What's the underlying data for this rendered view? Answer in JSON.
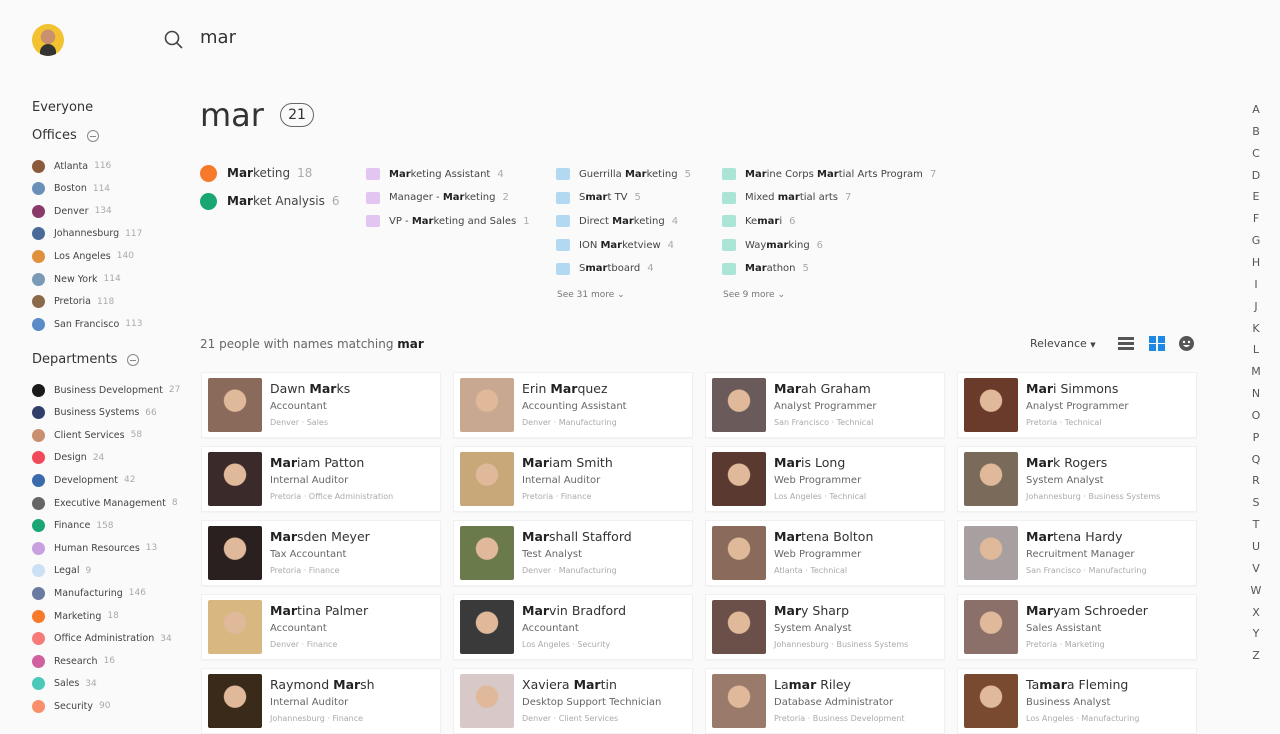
{
  "search": {
    "value": "mar"
  },
  "sidebar": {
    "everyone": "Everyone",
    "offices_title": "Offices",
    "departments_title": "Departments",
    "offices": [
      {
        "label": "Atlanta",
        "count": "116",
        "color": "#8a5a3c"
      },
      {
        "label": "Boston",
        "count": "114",
        "color": "#6a8fb8"
      },
      {
        "label": "Denver",
        "count": "134",
        "color": "#8a3a6a"
      },
      {
        "label": "Johannesburg",
        "count": "117",
        "color": "#4a6a9a"
      },
      {
        "label": "Los Angeles",
        "count": "140",
        "color": "#e0903a"
      },
      {
        "label": "New York",
        "count": "114",
        "color": "#7a9ab8"
      },
      {
        "label": "Pretoria",
        "count": "118",
        "color": "#8a6a4a"
      },
      {
        "label": "San Francisco",
        "count": "113",
        "color": "#5a8ac8"
      }
    ],
    "departments": [
      {
        "label": "Business Development",
        "count": "27",
        "color": "#1a1a1a"
      },
      {
        "label": "Business Systems",
        "count": "66",
        "color": "#2f3f6a"
      },
      {
        "label": "Client Services",
        "count": "58",
        "color": "#c98f6e"
      },
      {
        "label": "Design",
        "count": "24",
        "color": "#f04a5a"
      },
      {
        "label": "Development",
        "count": "42",
        "color": "#3a6aaa"
      },
      {
        "label": "Executive Management",
        "count": "8",
        "color": "#666666"
      },
      {
        "label": "Finance",
        "count": "158",
        "color": "#1aa673"
      },
      {
        "label": "Human Resources",
        "count": "13",
        "color": "#c8a0e0"
      },
      {
        "label": "Legal",
        "count": "9",
        "color": "#cce0f5"
      },
      {
        "label": "Manufacturing",
        "count": "146",
        "color": "#6a7aa0"
      },
      {
        "label": "Marketing",
        "count": "18",
        "color": "#f77a2a"
      },
      {
        "label": "Office Administration",
        "count": "34",
        "color": "#f77a7a"
      },
      {
        "label": "Research",
        "count": "16",
        "color": "#d060a0"
      },
      {
        "label": "Sales",
        "count": "34",
        "color": "#4ac8b8"
      },
      {
        "label": "Security",
        "count": "90",
        "color": "#f7906a"
      }
    ]
  },
  "query": {
    "title": "mar",
    "count": "21"
  },
  "suggestions": {
    "departments": [
      {
        "parts": [
          "",
          "Mar",
          "keting"
        ],
        "count": "18",
        "color": "#f77a2a"
      },
      {
        "parts": [
          "",
          "Mar",
          "ket Analysis"
        ],
        "count": "6",
        "color": "#1aa673"
      }
    ],
    "titles": [
      {
        "parts": [
          "",
          "Mar",
          "keting Assistant"
        ],
        "count": "4"
      },
      {
        "parts": [
          "Manager - ",
          "Mar",
          "keting"
        ],
        "count": "2"
      },
      {
        "parts": [
          "VP - ",
          "Mar",
          "keting and Sales"
        ],
        "count": "1"
      }
    ],
    "skills": [
      {
        "parts": [
          "Guerrilla ",
          "Mar",
          "keting"
        ],
        "count": "5"
      },
      {
        "parts": [
          "S",
          "mar",
          "t TV"
        ],
        "count": "5"
      },
      {
        "parts": [
          "Direct ",
          "Mar",
          "keting"
        ],
        "count": "4"
      },
      {
        "parts": [
          "ION ",
          "Mar",
          "ketview"
        ],
        "count": "4"
      },
      {
        "parts": [
          "S",
          "mar",
          "tboard"
        ],
        "count": "4"
      }
    ],
    "skills_more": "See 31 more",
    "interests": [
      {
        "parts": [
          "",
          "Mar",
          "ine Corps ",
          "Mar",
          "tial Arts Program"
        ],
        "count": "7"
      },
      {
        "parts": [
          "Mixed ",
          "mar",
          "tial arts"
        ],
        "count": "7"
      },
      {
        "parts": [
          "Ke",
          "mar",
          "i"
        ],
        "count": "6"
      },
      {
        "parts": [
          "Way",
          "mar",
          "king"
        ],
        "count": "6"
      },
      {
        "parts": [
          "",
          "Mar",
          "athon"
        ],
        "count": "5"
      }
    ],
    "interests_more": "See 9 more",
    "title_icon": "briefcase-icon",
    "skill_icon": "tools-icon",
    "interest_icon": "theater-masks-icon",
    "title_color": "#c98fe8",
    "skill_color": "#6ab8e8",
    "interest_color": "#5ad0b0"
  },
  "results": {
    "summary_prefix": "21 people with names matching ",
    "summary_query": "mar",
    "sort": "Relevance",
    "view_active": "grid",
    "accent": "#1e88e5",
    "people": [
      {
        "name": [
          "Dawn ",
          "Mar",
          "ks"
        ],
        "title": "Accountant",
        "loc": "Denver · Sales",
        "color": "#8a6a5a"
      },
      {
        "name": [
          "Erin ",
          "Mar",
          "quez"
        ],
        "title": "Accounting Assistant",
        "loc": "Denver · Manufacturing",
        "color": "#c8a890"
      },
      {
        "name": [
          "",
          "Mar",
          "ah Graham"
        ],
        "title": "Analyst Programmer",
        "loc": "San Francisco · Technical",
        "color": "#6a5a5a"
      },
      {
        "name": [
          "",
          "Mar",
          "i Simmons"
        ],
        "title": "Analyst Programmer",
        "loc": "Pretoria · Technical",
        "color": "#6a3a2a"
      },
      {
        "name": [
          "",
          "Mar",
          "iam Patton"
        ],
        "title": "Internal Auditor",
        "loc": "Pretoria · Office Administration",
        "color": "#3a2a2a"
      },
      {
        "name": [
          "",
          "Mar",
          "iam Smith"
        ],
        "title": "Internal Auditor",
        "loc": "Pretoria · Finance",
        "color": "#c8a878"
      },
      {
        "name": [
          "",
          "Mar",
          "is Long"
        ],
        "title": "Web Programmer",
        "loc": "Los Angeles · Technical",
        "color": "#5a3a30"
      },
      {
        "name": [
          "",
          "Mar",
          "k Rogers"
        ],
        "title": "System Analyst",
        "loc": "Johannesburg · Business Systems",
        "color": "#7a6a5a"
      },
      {
        "name": [
          "",
          "Mar",
          "sden Meyer"
        ],
        "title": "Tax Accountant",
        "loc": "Pretoria · Finance",
        "color": "#2a2020"
      },
      {
        "name": [
          "",
          "Mar",
          "shall Stafford"
        ],
        "title": "Test Analyst",
        "loc": "Denver · Manufacturing",
        "color": "#6a7a4a"
      },
      {
        "name": [
          "",
          "Mar",
          "tena Bolton"
        ],
        "title": "Web Programmer",
        "loc": "Atlanta · Technical",
        "color": "#8a6a5a"
      },
      {
        "name": [
          "",
          "Mar",
          "tena Hardy"
        ],
        "title": "Recruitment Manager",
        "loc": "San Francisco · Manufacturing",
        "color": "#a8a0a0"
      },
      {
        "name": [
          "",
          "Mar",
          "tina Palmer"
        ],
        "title": "Accountant",
        "loc": "Denver · Finance",
        "color": "#d8b880"
      },
      {
        "name": [
          "",
          "Mar",
          "vin Bradford"
        ],
        "title": "Accountant",
        "loc": "Los Angeles · Security",
        "color": "#3a3a3a"
      },
      {
        "name": [
          "",
          "Mar",
          "y Sharp"
        ],
        "title": "System Analyst",
        "loc": "Johannesburg · Business Systems",
        "color": "#6a5048"
      },
      {
        "name": [
          "",
          "Mar",
          "yam Schroeder"
        ],
        "title": "Sales Assistant",
        "loc": "Pretoria · Marketing",
        "color": "#8a7068"
      },
      {
        "name": [
          "Raymond ",
          "Mar",
          "sh"
        ],
        "title": "Internal Auditor",
        "loc": "Johannesburg · Finance",
        "color": "#3a2a1a"
      },
      {
        "name": [
          "Xaviera ",
          "Mar",
          "tin"
        ],
        "title": "Desktop Support Technician",
        "loc": "Denver · Client Services",
        "color": "#d8c8c8"
      },
      {
        "name": [
          "La",
          "mar",
          " Riley"
        ],
        "title": "Database Administrator",
        "loc": "Pretoria · Business Development",
        "color": "#9a7a6a"
      },
      {
        "name": [
          "Ta",
          "mar",
          "a Fleming"
        ],
        "title": "Business Analyst",
        "loc": "Los Angeles · Manufacturing",
        "color": "#7a4a30"
      }
    ]
  },
  "alphabet": [
    "A",
    "B",
    "C",
    "D",
    "E",
    "F",
    "G",
    "H",
    "I",
    "J",
    "K",
    "L",
    "M",
    "N",
    "O",
    "P",
    "Q",
    "R",
    "S",
    "T",
    "U",
    "V",
    "W",
    "X",
    "Y",
    "Z"
  ]
}
